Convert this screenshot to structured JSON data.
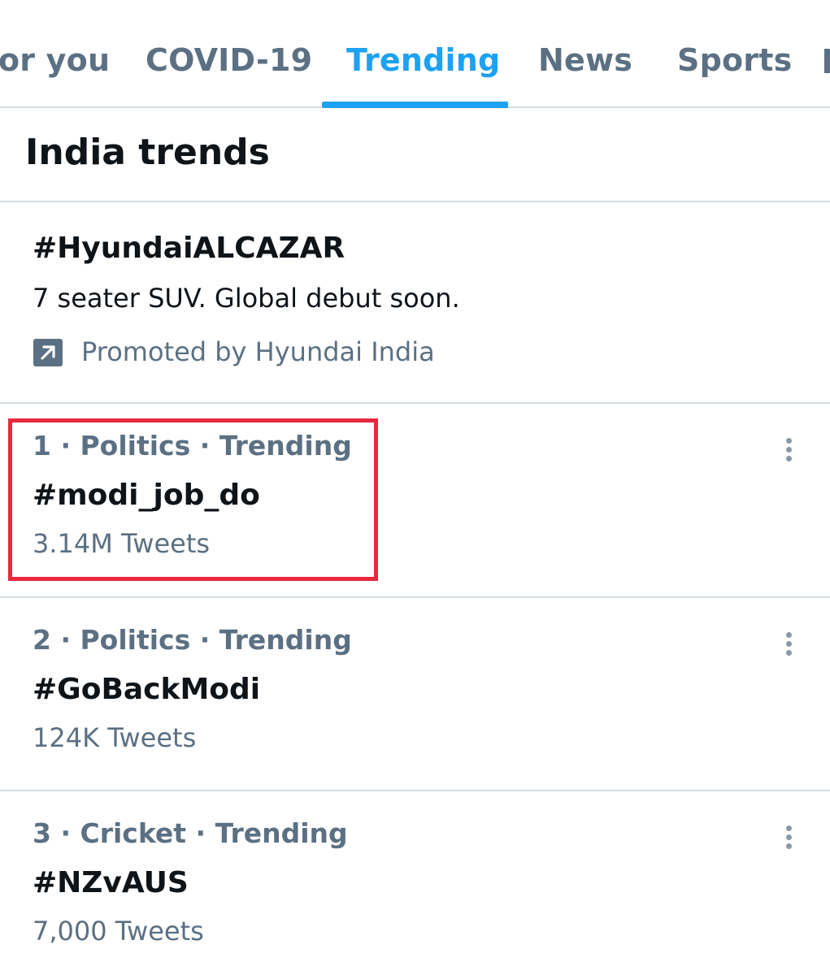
{
  "tabs": [
    {
      "label": "or you",
      "active": false
    },
    {
      "label": "COVID-19",
      "active": false
    },
    {
      "label": "Trending",
      "active": true
    },
    {
      "label": "News",
      "active": false
    },
    {
      "label": "Sports",
      "active": false
    }
  ],
  "section": {
    "title": "India trends"
  },
  "promoted": {
    "hashtag": "#HyundaiALCAZAR",
    "description": "7 seater SUV. Global debut soon.",
    "promoted_by": "Promoted by Hyundai India",
    "icon": "promoted-arrow-icon"
  },
  "trends": [
    {
      "meta": "1 · Politics · Trending",
      "hashtag": "#modi_job_do",
      "count": "3.14M Tweets",
      "highlighted": true
    },
    {
      "meta": "2 · Politics · Trending",
      "hashtag": "#GoBackModi",
      "count": "124K Tweets",
      "highlighted": false
    },
    {
      "meta": "3 · Cricket · Trending",
      "hashtag": "#NZvAUS",
      "count": "7,000 Tweets",
      "highlighted": false
    }
  ],
  "colors": {
    "accent": "#1da1f2",
    "text_primary": "#0f1419",
    "text_secondary": "#5b7083",
    "divider": "#d5dde3",
    "highlight": "#e8283e"
  }
}
